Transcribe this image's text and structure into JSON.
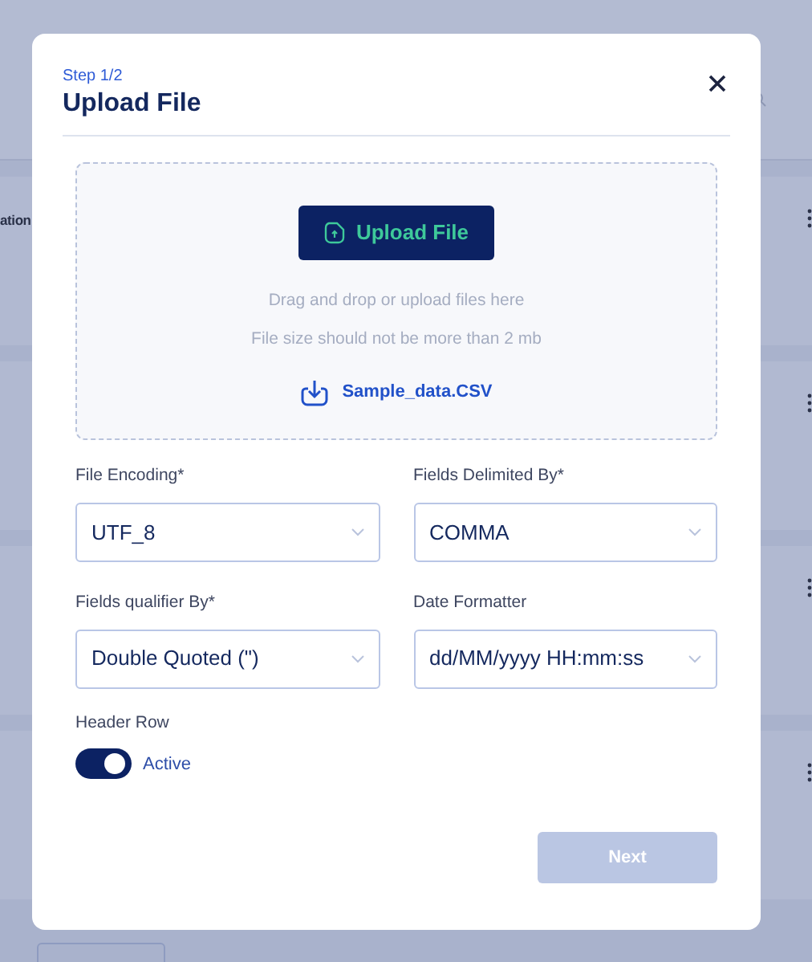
{
  "background": {
    "partial_text": "ation"
  },
  "modal": {
    "step": "Step 1/2",
    "title": "Upload File",
    "upload": {
      "button": "Upload File",
      "hint": "Drag and drop or upload files here",
      "size_note": "File size should not be more than 2 mb",
      "sample_link": "Sample_data.CSV"
    },
    "fields": [
      {
        "label": "File Encoding*",
        "value": "UTF_8"
      },
      {
        "label": "Fields Delimited By*",
        "value": "COMMA"
      },
      {
        "label": "Fields qualifier By*",
        "value": "Double Quoted (\")"
      },
      {
        "label": "Date Formatter",
        "value": "dd/MM/yyyy HH:mm:ss"
      }
    ],
    "header_row": {
      "label": "Header Row",
      "checked": true,
      "state_text": "Active"
    },
    "next_button": {
      "label": "Next",
      "disabled": true
    }
  }
}
